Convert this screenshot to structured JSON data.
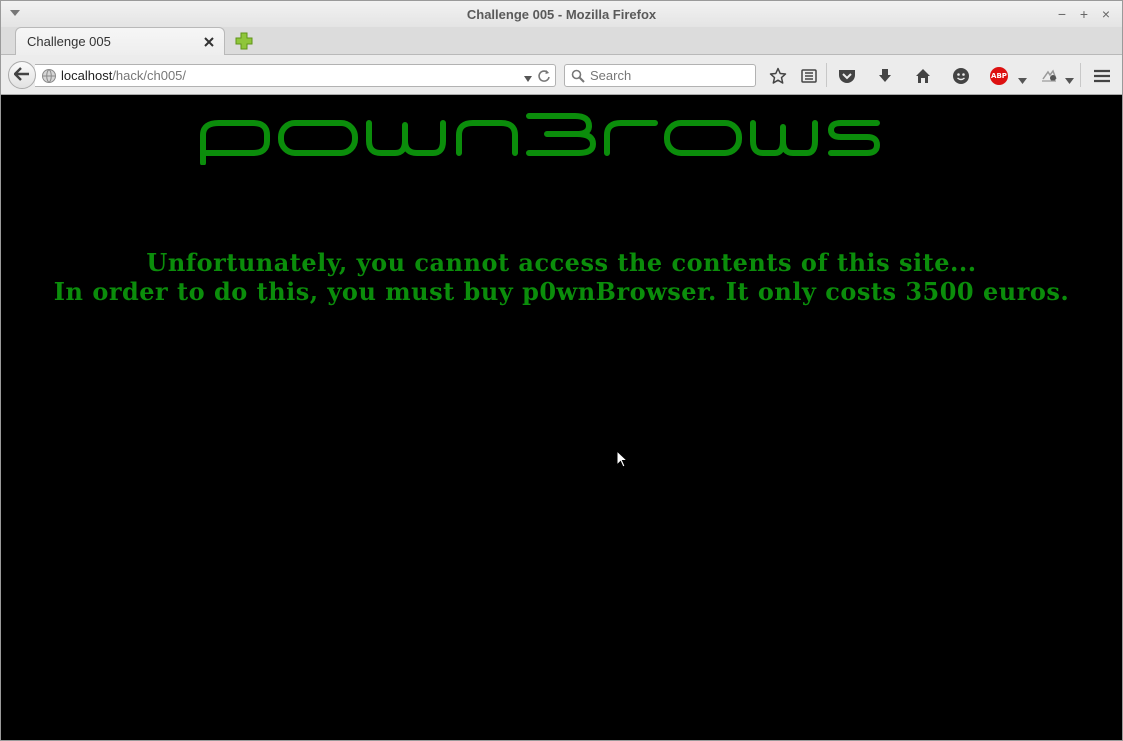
{
  "window": {
    "title": "Challenge 005 - Mozilla Firefox",
    "controls": {
      "minimize": "−",
      "maximize": "+",
      "close": "×"
    }
  },
  "tabs": [
    {
      "label": "Challenge 005",
      "active": true
    }
  ],
  "navbar": {
    "url_host": "localhost",
    "url_path": "/hack/ch005/",
    "search_placeholder": "Search",
    "abp_label": "ABP"
  },
  "page": {
    "logo_text": "p0wnBrowser",
    "logo_color": "#0b8d0b",
    "background_color": "#000000",
    "text_color": "#0b8d0b",
    "message_line1": "Unfortunately, you cannot access the contents of this site...",
    "message_line2": "In order to do this, you must buy p0wnBrowser. It only costs 3500 euros."
  },
  "icons": [
    "window-menu-icon",
    "tab-close-icon",
    "new-tab-icon",
    "back-icon",
    "globe-icon",
    "url-dropdown-icon",
    "reload-icon",
    "search-icon",
    "bookmark-star-icon",
    "reading-list-icon",
    "pocket-icon",
    "download-icon",
    "home-icon",
    "hello-icon",
    "adblock-icon",
    "extension-icon",
    "menu-icon"
  ]
}
